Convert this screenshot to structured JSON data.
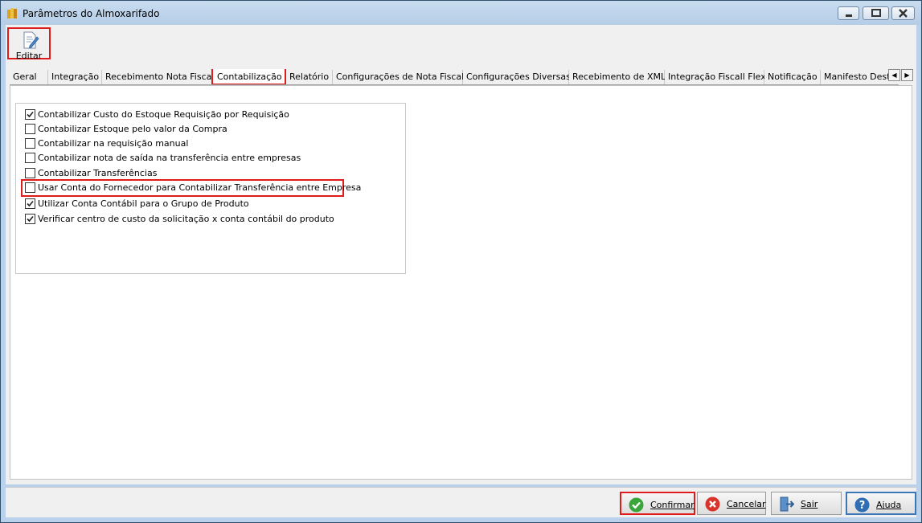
{
  "window": {
    "title": "Parâmetros do Almoxarifado"
  },
  "toolbar": {
    "edit_label": "Editar"
  },
  "tabs": [
    {
      "label": "Geral"
    },
    {
      "label": "Integração"
    },
    {
      "label": "Recebimento Nota Fiscal"
    },
    {
      "label": "Contabilização"
    },
    {
      "label": "Relatório"
    },
    {
      "label": "Configurações de Nota Fiscal"
    },
    {
      "label": "Configurações Diversas"
    },
    {
      "label": "Recebimento de XML"
    },
    {
      "label": "Integração Fiscall Flex"
    },
    {
      "label": "Notificação"
    },
    {
      "label": "Manifesto Dest"
    }
  ],
  "options": [
    {
      "label": "Contabilizar Custo do Estoque Requisição por Requisição",
      "checked": true
    },
    {
      "label": "Contabilizar Estoque pelo valor da Compra",
      "checked": false
    },
    {
      "label": "Contabilizar na requisição manual",
      "checked": false
    },
    {
      "label": "Contabilizar nota de saída na transferência entre empresas",
      "checked": false
    },
    {
      "label": "Contabilizar Transferências",
      "checked": false
    },
    {
      "label": "Usar Conta do Fornecedor para Contabilizar Transferência entre Empresa",
      "checked": false
    },
    {
      "label": "Utilizar Conta Contábil para o Grupo de Produto",
      "checked": true
    },
    {
      "label": "Verificar centro de custo da solicitação x conta contábil do produto",
      "checked": true
    }
  ],
  "buttons": {
    "confirm": "Confirmar",
    "cancel": "Cancelar",
    "exit": "Sair",
    "help": "Ajuda"
  },
  "colors": {
    "highlight": "#e01b1b",
    "confirm_icon": "#3aa63a",
    "cancel_icon": "#d9342b",
    "help_icon": "#2f6db5"
  }
}
